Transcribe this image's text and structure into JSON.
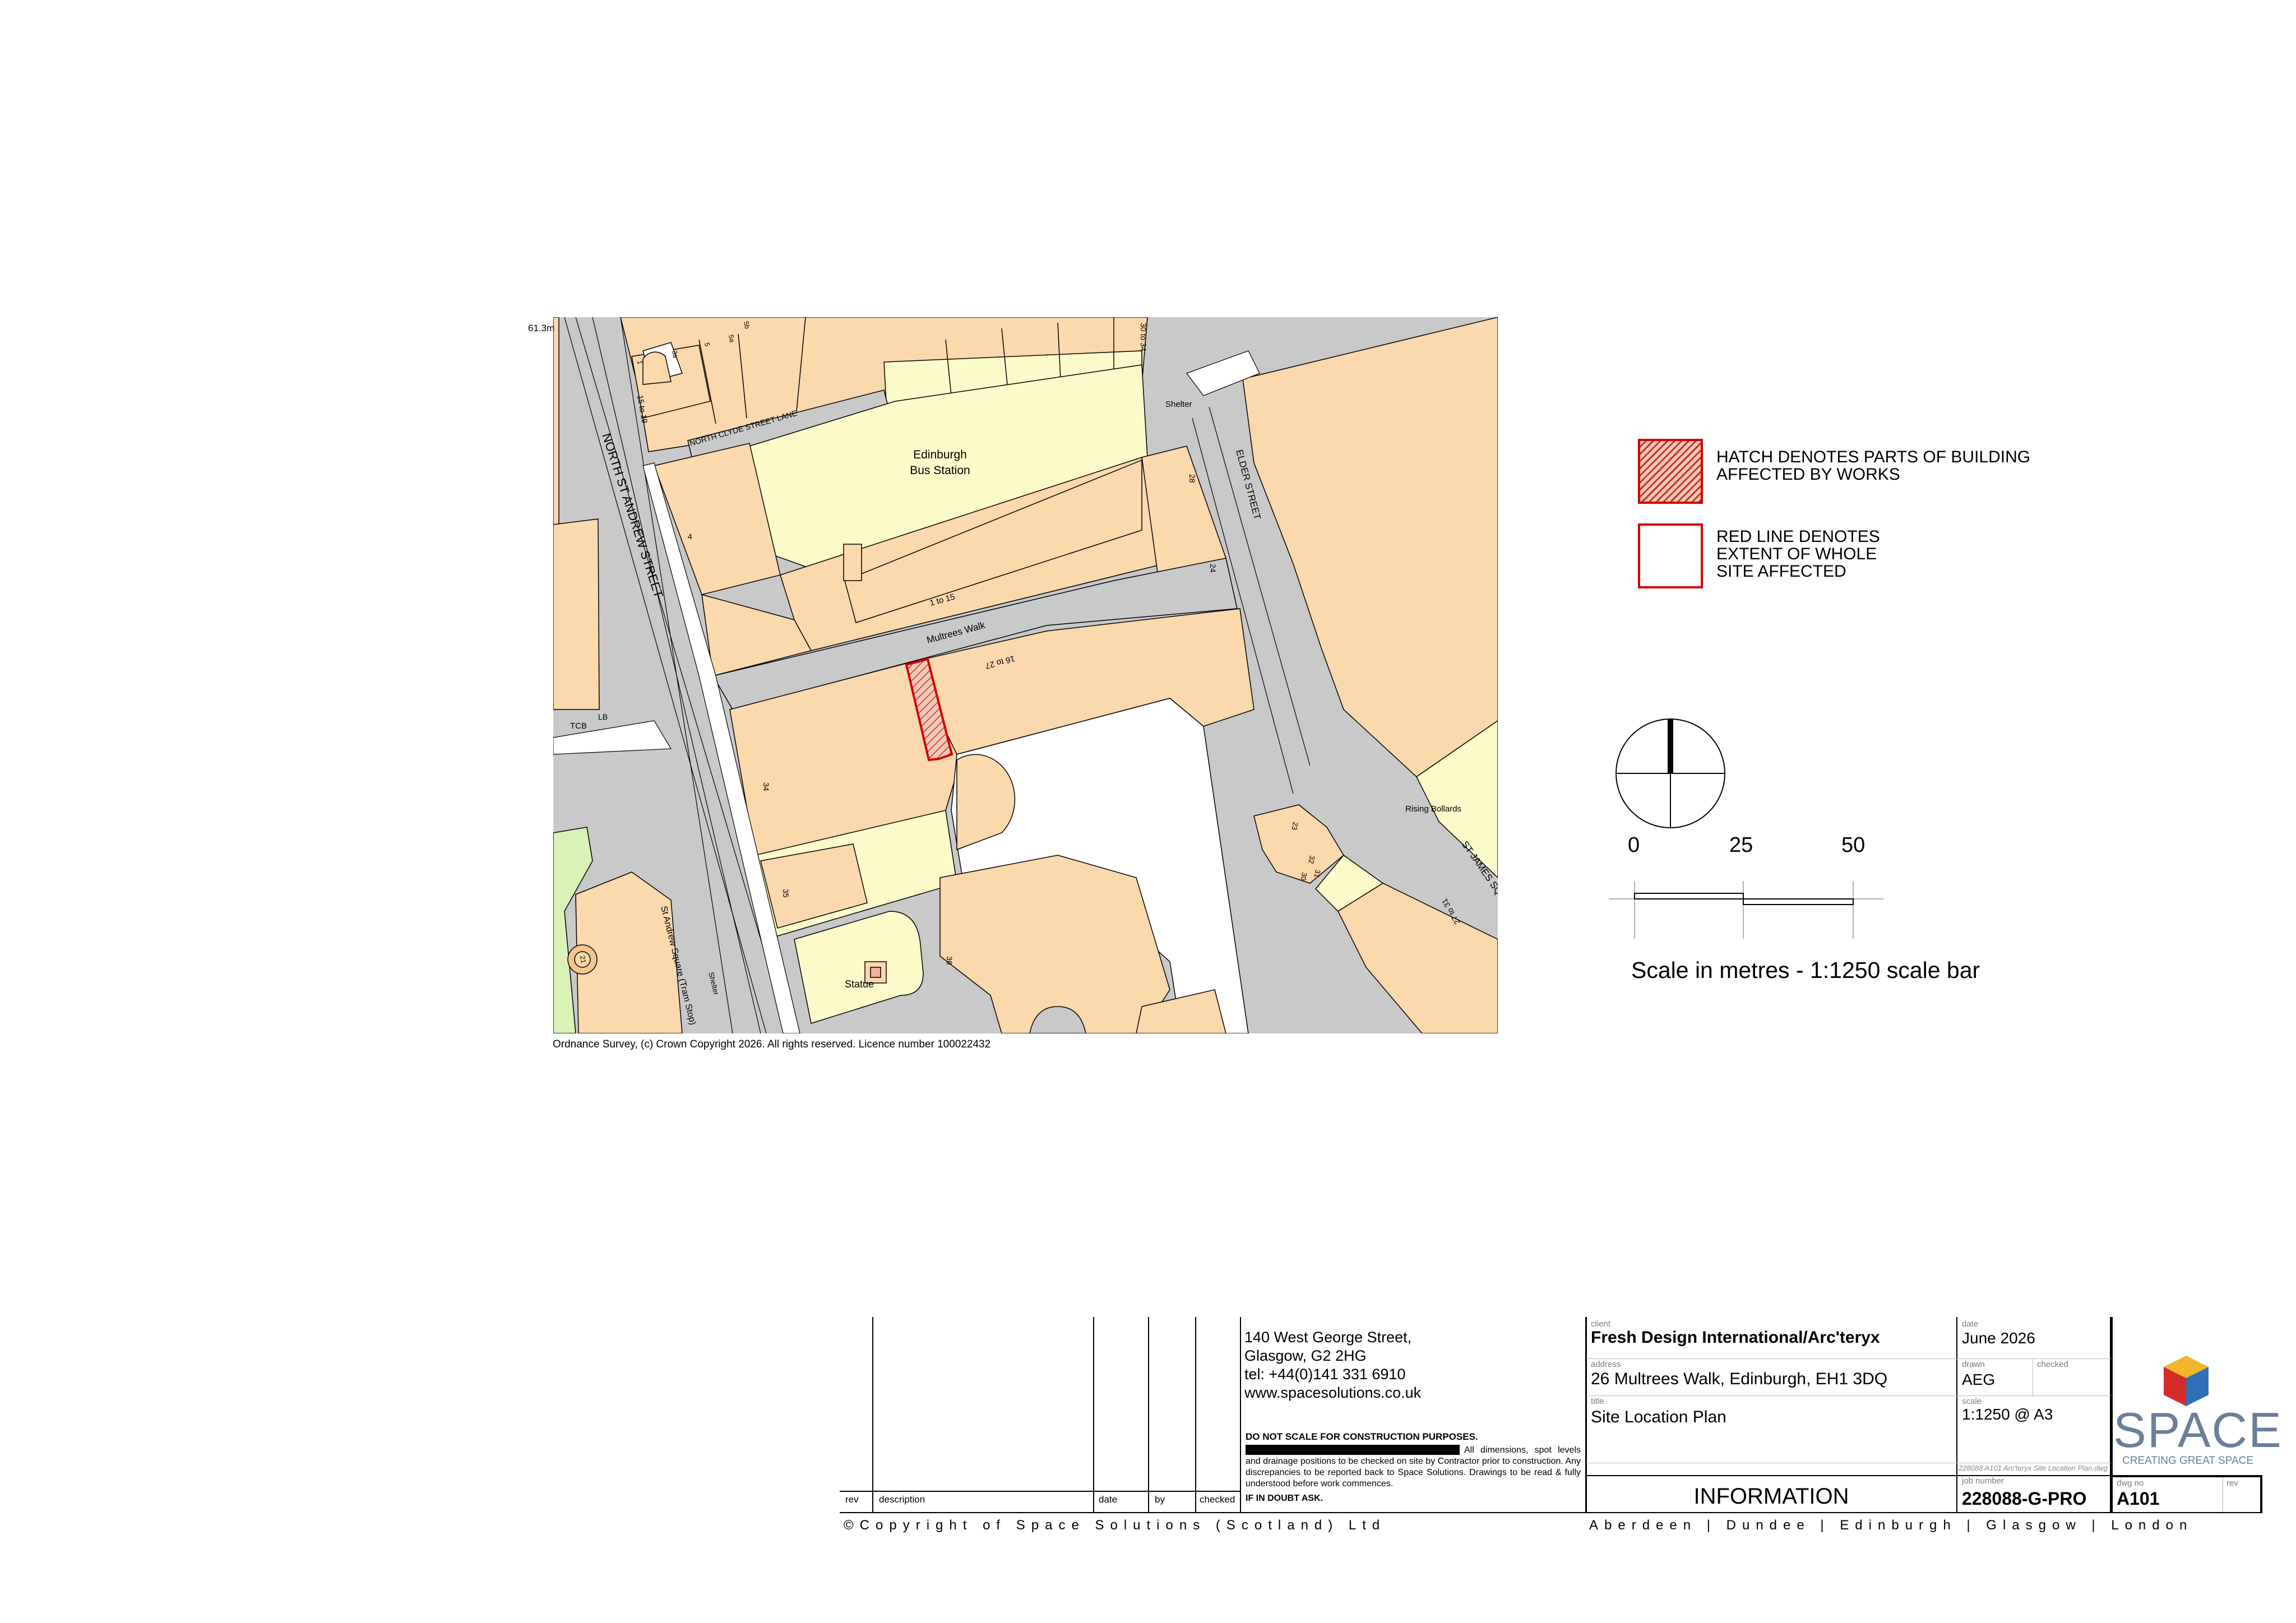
{
  "map": {
    "spot_height": "61.3m",
    "labels": {
      "bus_station_1": "Edinburgh",
      "bus_station_2": "Bus Station",
      "north_st_andrew": "NORTH ST ANDREW STREET",
      "north_clyde": "NORTH CLYDE STREET LANE",
      "elder_street": "ELDER STREET",
      "multrees_walk": "Multrees Walk",
      "st_james": "ST JAMES SQUARE",
      "st_andrew_tram": "St Andrew Square (Tram Stop)",
      "rising_bollards": "Rising Bollards",
      "statue": "Statue",
      "shelter_top": "Shelter",
      "shelter_left": "Shelter",
      "tcb": "TCB",
      "lb": "LB",
      "n_1to15": "1 to 15",
      "n_16to27": "16 to 27",
      "n_15to19": "15 to 19",
      "n_27to31": "27 to 31",
      "n_30to34": "30 to 34",
      "n_4": "4",
      "n_24": "24",
      "n_28": "28",
      "n_34": "34",
      "n_35": "35",
      "n_36": "36",
      "n_32": "32",
      "n_23": "23",
      "n_31": "31",
      "n_30": "30",
      "n_5a": "5a",
      "n_5b": "5b",
      "n_5": "5",
      "n_3a": "3a",
      "n_1": "1",
      "n_21": "21"
    },
    "copyright": "Ordnance Survey, (c) Crown Copyright 2026. All rights reserved. Licence number 100022432"
  },
  "legend": {
    "hatch_text_1": "HATCH DENOTES PARTS OF BUILDING",
    "hatch_text_2": "AFFECTED BY WORKS",
    "red_text_1": "RED LINE DENOTES",
    "red_text_2": "EXTENT OF WHOLE",
    "red_text_3": "SITE AFFECTED"
  },
  "scale": {
    "tick_0": "0",
    "tick_25": "25",
    "tick_50": "50",
    "caption": "Scale in metres - 1:1250 scale bar"
  },
  "title_block": {
    "revisions_header": {
      "rev": "rev",
      "description": "description",
      "date": "date",
      "by": "by",
      "checked": "checked"
    },
    "office_address": {
      "line1": "140 West George Street,",
      "line2": "Glasgow, G2 2HG",
      "line3": "tel: +44(0)141 331 6910",
      "line4": "www.spacesolutions.co.uk"
    },
    "warning_title": "DO NOT SCALE FOR CONSTRUCTION PURPOSES.",
    "warning_body": "All dimensions, spot levels and drainage positions to be checked on site by Contractor prior to construction. Any discrepancies to be reported back to Space Solutions. Drawings to be read & fully understood before work commences.",
    "warning_footer": "IF IN DOUBT ASK.",
    "client_label": "client",
    "client": "Fresh Design International/Arc'teryx",
    "address_label": "address",
    "address": "26 Multrees Walk, Edinburgh, EH1 3DQ",
    "title_label": "title",
    "title": "Site Location Plan",
    "date_label": "date",
    "date": "June 2026",
    "drawn_label": "drawn",
    "drawn": "AEG",
    "checked_label": "checked",
    "checked": "",
    "scale_label": "scale",
    "scale": "1:1250 @ A3",
    "file_path": "228088 A101 Arc'teryx Site Location Plan.dwg",
    "status": "INFORMATION",
    "job_number_label": "job number",
    "job_number": "228088-G-PRO",
    "dwg_no_label": "dwg no",
    "dwg_no": "A101",
    "rev_label": "rev",
    "rev": "",
    "logo_word": "SPACE",
    "logo_tagline": "CREATING GREAT SPACE",
    "copyright": "©Copyright of Space Solutions (Scotland) Ltd",
    "offices": "Aberdeen | Dundee | Edinburgh | Glasgow | London"
  },
  "colors": {
    "building_orange": "#fcd8ad",
    "building_yellow": "#fdfac9",
    "road_grey": "#c9c9c9",
    "pavement_white": "#ffffff",
    "green": "#d8f2b8",
    "red_boundary": "#d40000",
    "logo_blue": "#2f6fb7",
    "logo_red": "#d62b2b",
    "logo_yellow": "#f2b62a",
    "logo_text": "#6b7f99"
  }
}
